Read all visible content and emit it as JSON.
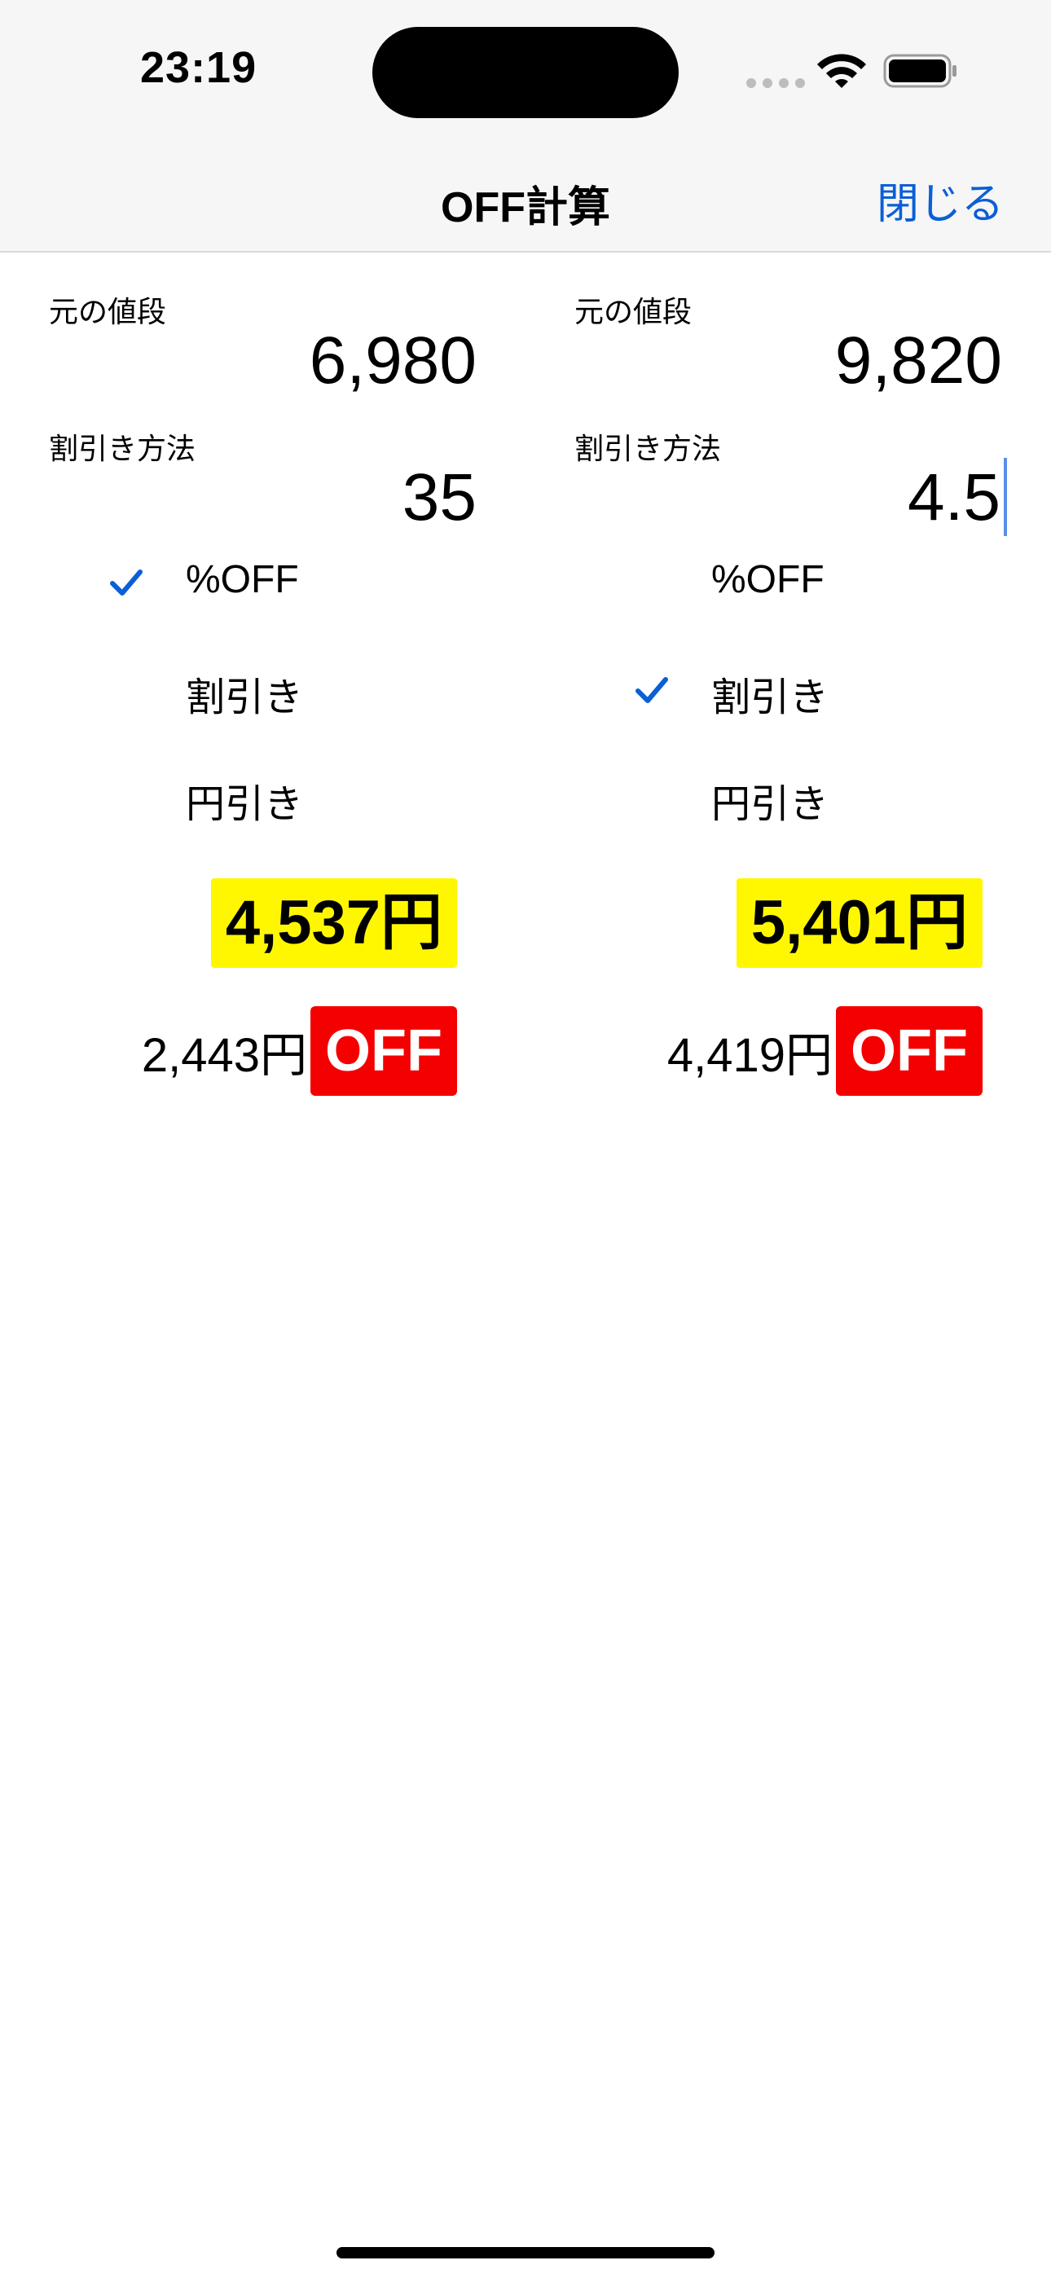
{
  "status_bar": {
    "time": "23:19"
  },
  "nav": {
    "title": "OFF計算",
    "close_label": "閉じる"
  },
  "accent_color": "#0b5fd6",
  "columns": [
    {
      "price_label": "元の値段",
      "price_value": "6,980",
      "method_label": "割引き方法",
      "method_value": "35",
      "options": [
        {
          "label": "%OFF",
          "selected": true
        },
        {
          "label": "割引き",
          "selected": false
        },
        {
          "label": "円引き",
          "selected": false
        }
      ],
      "result": "4,537円",
      "discount_amount": "2,443円",
      "off_badge": "OFF"
    },
    {
      "price_label": "元の値段",
      "price_value": "9,820",
      "method_label": "割引き方法",
      "method_value": "4.5",
      "options": [
        {
          "label": "%OFF",
          "selected": false
        },
        {
          "label": "割引き",
          "selected": true
        },
        {
          "label": "円引き",
          "selected": false
        }
      ],
      "result": "5,401円",
      "discount_amount": "4,419円",
      "off_badge": "OFF"
    }
  ]
}
